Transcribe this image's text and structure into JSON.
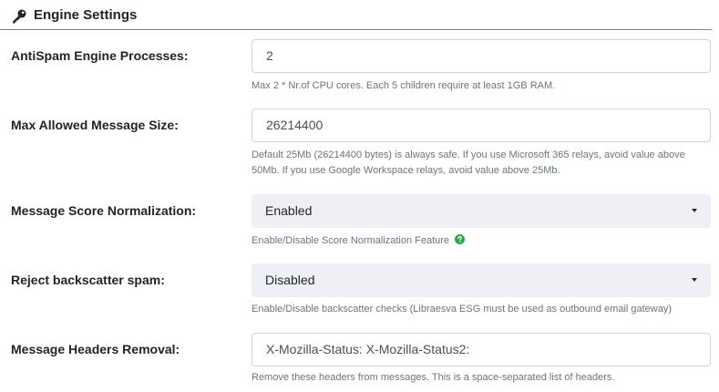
{
  "section": {
    "title": "Engine Settings",
    "icon": "key-icon",
    "accent_color": "#4caf50"
  },
  "fields": {
    "processes": {
      "label": "AntiSpam Engine Processes:",
      "value": "2",
      "help": "Max 2 * Nr.of CPU cores. Each 5 children require at least 1GB RAM."
    },
    "max_size": {
      "label": "Max Allowed Message Size:",
      "value": "26214400",
      "help": "Default 25Mb (26214400 bytes) is always safe. If you use Microsoft 365 relays, avoid value above 50Mb. If you use Google Workspace relays, avoid value above 25Mb."
    },
    "normalization": {
      "label": "Message Score Normalization:",
      "selected": "Enabled",
      "help": "Enable/Disable Score Normalization Feature",
      "help_icon": "question-circle-icon",
      "help_icon_color": "#28a745"
    },
    "backscatter": {
      "label": "Reject backscatter spam:",
      "selected": "Disabled",
      "help": "Enable/Disable backscatter checks (Libraesva ESG must be used as outbound email gateway)"
    },
    "headers_removal": {
      "label": "Message Headers Removal:",
      "value": "X-Mozilla-Status: X-Mozilla-Status2:",
      "help": "Remove these headers from messages. This is a space-separated list of headers."
    }
  }
}
